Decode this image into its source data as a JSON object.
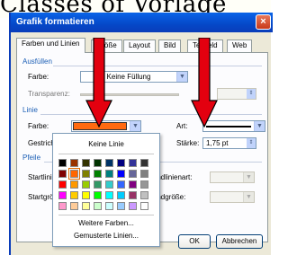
{
  "dialog": {
    "title": "Grafik formatieren",
    "close_label": "×",
    "tabs": [
      {
        "label": "Farben und Linien",
        "active": true
      },
      {
        "label": "Größe",
        "active": false
      },
      {
        "label": "Layout",
        "active": false
      },
      {
        "label": "Bild",
        "active": false
      },
      {
        "label": "Textfeld",
        "active": false
      },
      {
        "label": "Web",
        "active": false
      }
    ],
    "fill": {
      "section_label": "Ausfüllen",
      "color_label": "Farbe:",
      "color_value": "Keine Füllung",
      "transparency_label": "Transparenz:"
    },
    "line": {
      "section_label": "Linie",
      "color_label": "Farbe:",
      "color_value": "#ff6a10",
      "dash_label": "Gestrichelt:",
      "type_label": "Art:",
      "weight_label": "Stärke:",
      "weight_value": "1,75 pt"
    },
    "arrows": {
      "section_label": "Pfeile",
      "start_type_label": "Startlinienart:",
      "start_size_label": "Startgröße:",
      "end_type_label": "Endlinienart:",
      "end_size_label": "Endgröße:"
    },
    "buttons": {
      "ok_label": "OK",
      "cancel_label": "Abbrechen"
    }
  },
  "color_popup": {
    "no_line_label": "Keine Linie",
    "more_colors_label": "Weitere Farben...",
    "patterned_lines_label": "Gemusterte Linien...",
    "swatches": [
      [
        "#000000",
        "#993300",
        "#333300",
        "#003300",
        "#003366",
        "#000080",
        "#333399",
        "#333333"
      ],
      [
        "#800000",
        "#ff6600",
        "#808000",
        "#008000",
        "#008080",
        "#0000ff",
        "#666699",
        "#808080"
      ],
      [
        "#ff0000",
        "#ff9900",
        "#99cc00",
        "#339966",
        "#33cccc",
        "#3366ff",
        "#800080",
        "#969696"
      ],
      [
        "#ff00ff",
        "#ffcc00",
        "#ffff00",
        "#00ff00",
        "#00ffff",
        "#00ccff",
        "#993366",
        "#c0c0c0"
      ],
      [
        "#ff99cc",
        "#ffcc99",
        "#ffff99",
        "#ccffcc",
        "#ccffff",
        "#99ccff",
        "#cc99ff",
        "#ffffff"
      ]
    ],
    "selected_swatch": "#ff6600"
  },
  "background_text": "Classes of Vorlage",
  "annotation_color": "#e3000f"
}
